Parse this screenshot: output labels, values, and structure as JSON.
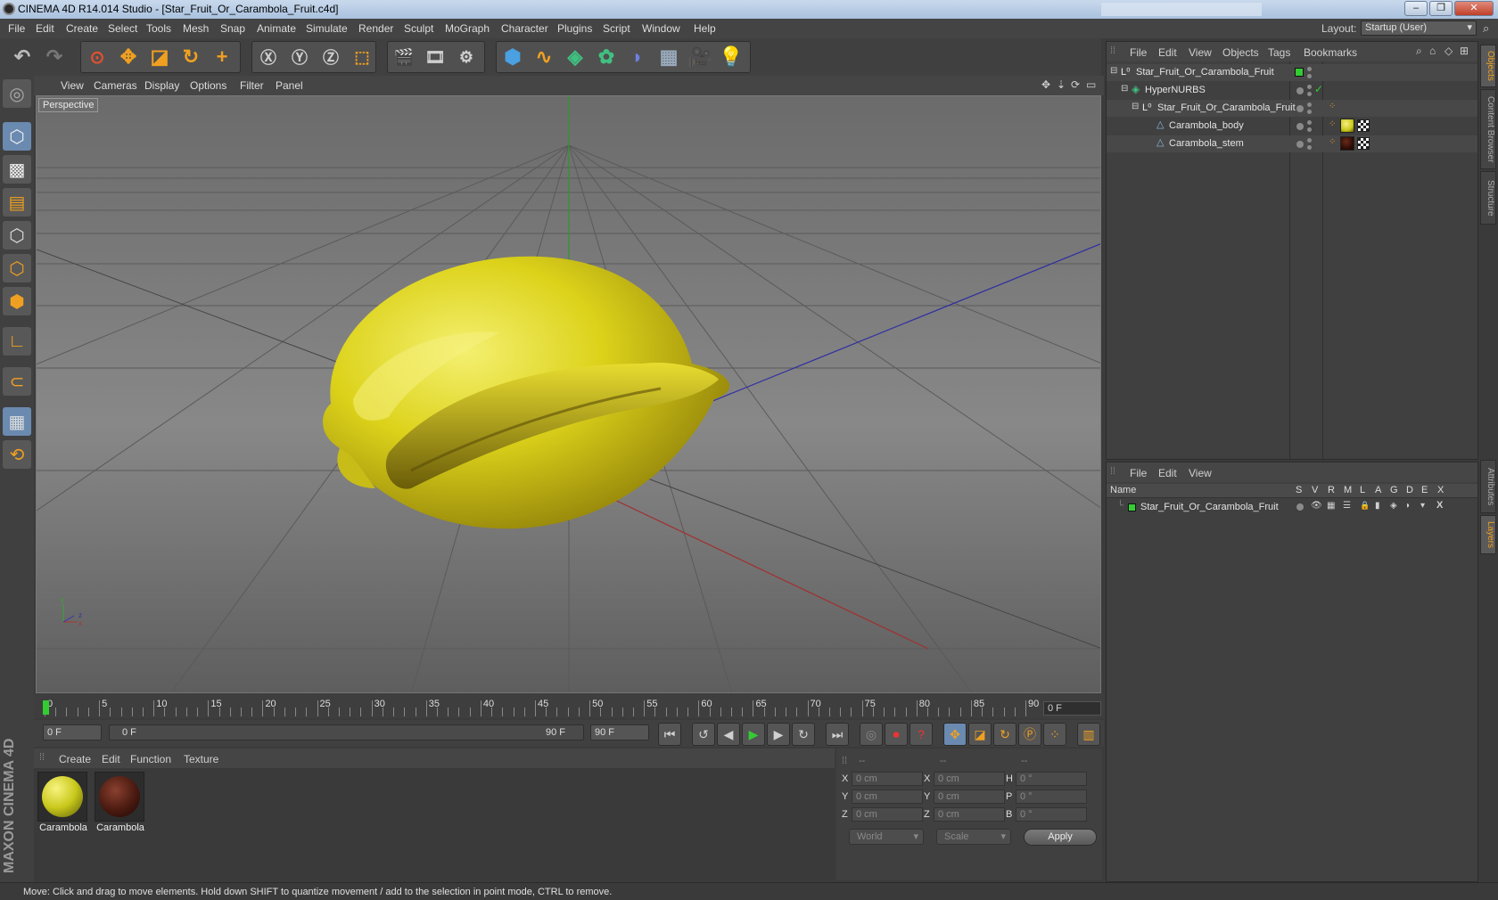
{
  "window": {
    "title": "CINEMA 4D R14.014 Studio - [Star_Fruit_Or_Carambola_Fruit.c4d]",
    "min": "–",
    "max": "❐",
    "close": "✕"
  },
  "menu": [
    "File",
    "Edit",
    "Create",
    "Select",
    "Tools",
    "Mesh",
    "Snap",
    "Animate",
    "Simulate",
    "Render",
    "Sculpt",
    "MoGraph",
    "Character",
    "Plugins",
    "Script",
    "Window",
    "Help"
  ],
  "layout": {
    "label": "Layout:",
    "value": "Startup (User)"
  },
  "viewport": {
    "menu": [
      "View",
      "Cameras",
      "Display",
      "Options",
      "Filter",
      "Panel"
    ],
    "label": "Perspective"
  },
  "timeline": {
    "ticks": [
      "0",
      "5",
      "10",
      "15",
      "20",
      "25",
      "30",
      "35",
      "40",
      "45",
      "50",
      "55",
      "60",
      "65",
      "70",
      "75",
      "80",
      "85",
      "90"
    ],
    "current": "0 F",
    "start": "0 F",
    "slider_left": "0 F",
    "slider_right": "90 F",
    "end": "90 F"
  },
  "materials": {
    "menu": [
      "Create",
      "Edit",
      "Function",
      "Texture"
    ],
    "items": [
      {
        "name": "Carambola",
        "color": "#c8c81c"
      },
      {
        "name": "Carambola",
        "color": "#4a1a10"
      }
    ]
  },
  "coords": {
    "headers": [
      "--",
      "--",
      "--"
    ],
    "rows": [
      {
        "a": "X",
        "av": "0 cm",
        "b": "X",
        "bv": "0 cm",
        "c": "H",
        "cv": "0 °"
      },
      {
        "a": "Y",
        "av": "0 cm",
        "b": "Y",
        "bv": "0 cm",
        "c": "P",
        "cv": "0 °"
      },
      {
        "a": "Z",
        "av": "0 cm",
        "b": "Z",
        "bv": "0 cm",
        "c": "B",
        "cv": "0 °"
      }
    ],
    "world": "World",
    "scale": "Scale",
    "apply": "Apply"
  },
  "status": "Move: Click and drag to move elements. Hold down SHIFT to quantize movement / add to the selection in point mode, CTRL to remove.",
  "objects": {
    "menu": [
      "File",
      "Edit",
      "View",
      "Objects",
      "Tags",
      "Bookmarks"
    ],
    "items": [
      "Star_Fruit_Or_Carambola_Fruit",
      "HyperNURBS",
      "Star_Fruit_Or_Carambola_Fruit",
      "Carambola_body",
      "Carambola_stem"
    ]
  },
  "layers": {
    "menu": [
      "File",
      "Edit",
      "View"
    ],
    "header": {
      "name": "Name",
      "cols": [
        "S",
        "V",
        "R",
        "M",
        "L",
        "A",
        "G",
        "D",
        "E",
        "X"
      ]
    },
    "items": [
      "Star_Fruit_Or_Carambola_Fruit"
    ]
  },
  "right_tabs": [
    "Objects",
    "Content Browser",
    "Structure",
    "Attributes",
    "Layers"
  ],
  "brand": "MAXON CINEMA 4D",
  "accent": "#f0a020"
}
